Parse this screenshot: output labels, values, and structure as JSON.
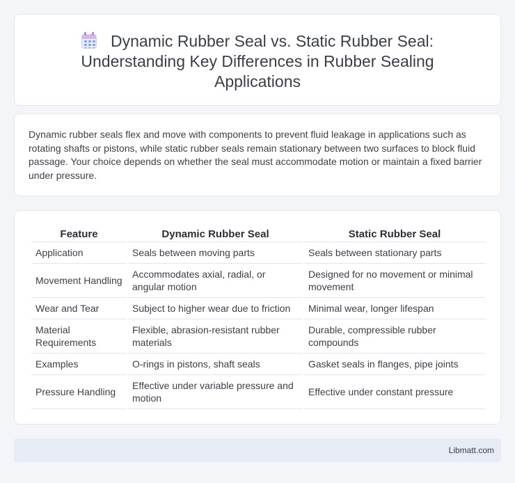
{
  "header": {
    "icon": "calendar-icon",
    "title": "Dynamic Rubber Seal vs. Static Rubber Seal: Understanding Key Differences in Rubber Sealing Applications"
  },
  "summary": {
    "text": "Dynamic rubber seals flex and move with components to prevent fluid leakage in applications such as rotating shafts or pistons, while static rubber seals remain stationary between two surfaces to block fluid passage. Your choice depends on whether the seal must accommodate motion or maintain a fixed barrier under pressure."
  },
  "table": {
    "headers": [
      "Feature",
      "Dynamic Rubber Seal",
      "Static Rubber Seal"
    ],
    "rows": [
      [
        "Application",
        "Seals between moving parts",
        "Seals between stationary parts"
      ],
      [
        "Movement Handling",
        "Accommodates axial, radial, or angular motion",
        "Designed for no movement or minimal movement"
      ],
      [
        "Wear and Tear",
        "Subject to higher wear due to friction",
        "Minimal wear, longer lifespan"
      ],
      [
        "Material Requirements",
        "Flexible, abrasion-resistant rubber materials",
        "Durable, compressible rubber compounds"
      ],
      [
        "Examples",
        "O-rings in pistons, shaft seals",
        "Gasket seals in flanges, pipe joints"
      ],
      [
        "Pressure Handling",
        "Effective under variable pressure and motion",
        "Effective under constant pressure"
      ]
    ]
  },
  "footer": {
    "brand": "Libmatt.com"
  }
}
